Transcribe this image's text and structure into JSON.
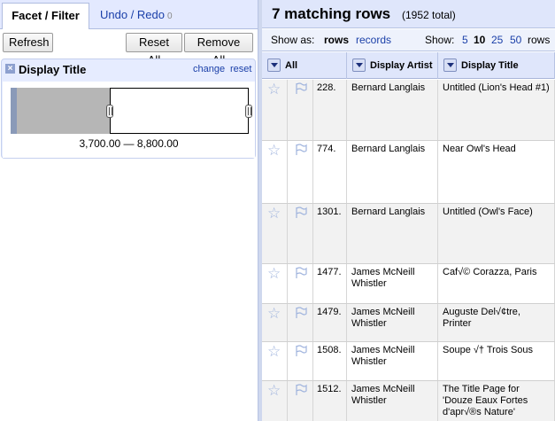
{
  "tabs": {
    "facet_filter": "Facet / Filter",
    "undo_redo": "Undo / Redo",
    "undo_count": "0"
  },
  "left_buttons": {
    "refresh": "Refresh",
    "reset_all": "Reset All",
    "remove_all": "Remove All"
  },
  "facet": {
    "close_icon": "x-icon",
    "title": "Display Title",
    "change": "change",
    "reset": "reset",
    "range_text": "3,700.00 — 8,800.00"
  },
  "summary": {
    "count_text": "7 matching rows",
    "total_text": "(1952 total)"
  },
  "controls": {
    "show_as": "Show as:",
    "rows": "rows",
    "records": "records",
    "show": "Show:",
    "page_sizes": [
      "5",
      "10",
      "25",
      "50"
    ],
    "selected_page_size": "10",
    "rows_word": "rows"
  },
  "columns": {
    "all": "All",
    "artist": "Display Artist",
    "title": "Display Title"
  },
  "rows": [
    {
      "num": "228.",
      "artist": "Bernard Langlais",
      "title": "Untitled (Lion's Head #1)"
    },
    {
      "num": "774.",
      "artist": "Bernard Langlais",
      "title": "Near Owl's Head"
    },
    {
      "num": "1301.",
      "artist": "Bernard Langlais",
      "title": "Untitled (Owl's Face)"
    },
    {
      "num": "1477.",
      "artist": "James McNeill Whistler",
      "title": "Caf√© Corazza, Paris"
    },
    {
      "num": "1479.",
      "artist": "James McNeill Whistler",
      "title": "Auguste Del√¢tre, Printer"
    },
    {
      "num": "1508.",
      "artist": "James McNeill Whistler",
      "title": "Soupe √† Trois Sous"
    },
    {
      "num": "1512.",
      "artist": "James McNeill Whistler",
      "title": "The Title Page for 'Douze Eaux Fortes d'apr√®s Nature'"
    }
  ],
  "colors": {
    "accent_link": "#1a3fa8",
    "header_bg": "#dfe6fb",
    "facet_bg": "#e6ecff"
  }
}
